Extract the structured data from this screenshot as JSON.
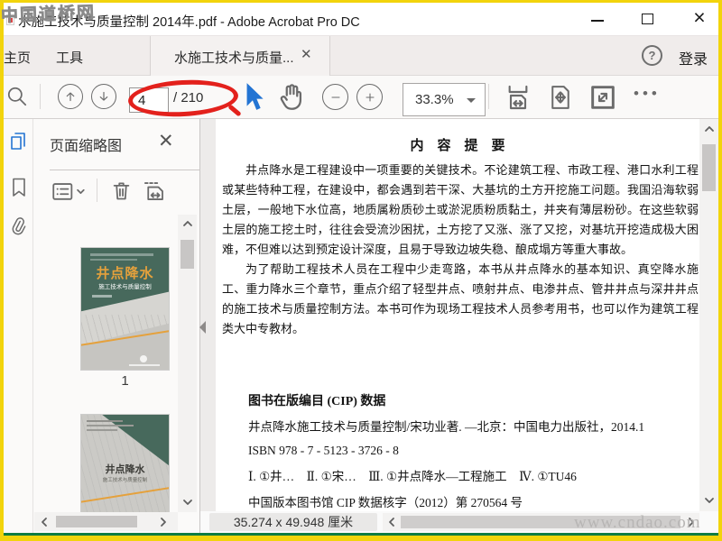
{
  "window": {
    "title": "水施工技术与质量控制 2014年.pdf - Adobe Acrobat Pro DC"
  },
  "watermark_top": "中国道桥网",
  "watermark_bottom": "www.cndao.com",
  "tabs": {
    "home": "主页",
    "tools": "工具",
    "document": "水施工技术与质量...",
    "sign_in": "登录"
  },
  "toolbar": {
    "page_current": "4",
    "page_total_label": "/ 210",
    "zoom_value": "33.3%",
    "more_dots": "•••"
  },
  "panel": {
    "title": "页面缩略图",
    "thumb1_label": "1",
    "cover_front": {
      "title": "井点降水",
      "subtitle": "施工技术与质量控制"
    },
    "cover_back": {
      "title": "井点降水",
      "subtitle": "施工技术与质量控制"
    }
  },
  "doc": {
    "heading": "内　容　提　要",
    "para1": "井点降水是工程建设中一项重要的关键技术。不论建筑工程、市政工程、港口水利工程或某些特种工程，在建设中，都会遇到若干深、大基坑的土方开挖施工问题。我国沿海软弱土层，一般地下水位高，地质属粉质砂土或淤泥质粉质黏土，并夹有薄层粉砂。在这些软弱土层的施工挖土时，往往会受流沙困扰，土方挖了又涨、涨了又挖，对基坑开挖造成极大困难，不但难以达到预定设计深度，且易于导致边坡失稳、酿成塌方等重大事故。",
    "para2": "为了帮助工程技术人员在工程中少走弯路，本书从井点降水的基本知识、真空降水施工、重力降水三个章节，重点介绍了轻型井点、喷射井点、电渗井点、管井井点与深井井点的施工技术与质量控制方法。本书可作为现场工程技术人员参考用书，也可以作为建筑工程类大中专教材。",
    "cip_heading": "图书在版编目 (CIP) 数据",
    "cip_line1": "井点降水施工技术与质量控制/宋功业著. —北京：中国电力出版社，2014.1",
    "cip_line2": "ISBN 978 - 7 - 5123 - 3726 - 8",
    "cip_line3": "Ⅰ. ①井…　Ⅱ. ①宋…　Ⅲ. ①井点降水—工程施工　Ⅳ. ①TU46",
    "cip_line4": "中国版本图书馆 CIP 数据核字（2012）第 270564 号"
  },
  "status": {
    "page_size": "35.274 x 49.948 厘米"
  },
  "colors": {
    "accent_yellow": "#f2d40c",
    "accent_green": "#0e7c43",
    "annotation_red": "#e3211c",
    "tool_blue": "#2374d3",
    "cover_green": "#47695c",
    "cover_orange": "#e5a13c"
  }
}
